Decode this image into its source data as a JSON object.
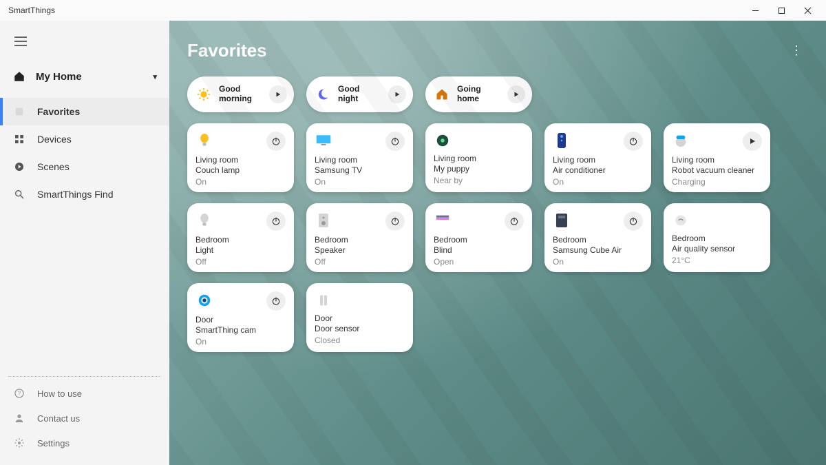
{
  "window": {
    "title": "SmartThings"
  },
  "sidebar": {
    "home_label": "My Home",
    "items": [
      {
        "label": "Favorites",
        "icon": "star"
      },
      {
        "label": "Devices",
        "icon": "grid"
      },
      {
        "label": "Scenes",
        "icon": "play-circle"
      },
      {
        "label": "SmartThings Find",
        "icon": "search-target"
      }
    ],
    "footer": [
      {
        "label": "How to use",
        "icon": "help"
      },
      {
        "label": "Contact us",
        "icon": "person"
      },
      {
        "label": "Settings",
        "icon": "gear"
      }
    ]
  },
  "page": {
    "title": "Favorites"
  },
  "scenes": [
    {
      "icon": "sun",
      "label": "Good\nmorning"
    },
    {
      "icon": "moon",
      "label": "Good\nnight"
    },
    {
      "icon": "house",
      "label": "Going\nhome"
    }
  ],
  "devices": [
    {
      "icon": "bulb-on",
      "action": "power",
      "room": "Living room",
      "name": "Couch lamp",
      "status": "On"
    },
    {
      "icon": "tv",
      "action": "power",
      "room": "Living room",
      "name": "Samsung TV",
      "status": "On"
    },
    {
      "icon": "tag",
      "action": "none",
      "room": "Living room",
      "name": "My puppy",
      "status": "Near by"
    },
    {
      "icon": "remote",
      "action": "power",
      "room": "Living room",
      "name": "Air conditioner",
      "status": "On"
    },
    {
      "icon": "robot-vac",
      "action": "play",
      "room": "Living room",
      "name": "Robot vacuum cleaner",
      "status": "Charging"
    },
    {
      "icon": "bulb-off",
      "action": "power",
      "room": "Bedroom",
      "name": "Light",
      "status": "Off"
    },
    {
      "icon": "speaker",
      "action": "power",
      "room": "Bedroom",
      "name": "Speaker",
      "status": "Off"
    },
    {
      "icon": "blind",
      "action": "power",
      "room": "Bedroom",
      "name": "Blind",
      "status": "Open"
    },
    {
      "icon": "cube",
      "action": "power",
      "room": "Bedroom",
      "name": "Samsung Cube Air",
      "status": "On"
    },
    {
      "icon": "air",
      "action": "none",
      "room": "Bedroom",
      "name": "Air quality sensor",
      "status": "21°C"
    },
    {
      "icon": "camera",
      "action": "power",
      "room": "Door",
      "name": "SmartThing cam",
      "status": "On"
    },
    {
      "icon": "door",
      "action": "none",
      "room": "Door",
      "name": "Door sensor",
      "status": "Closed"
    }
  ]
}
